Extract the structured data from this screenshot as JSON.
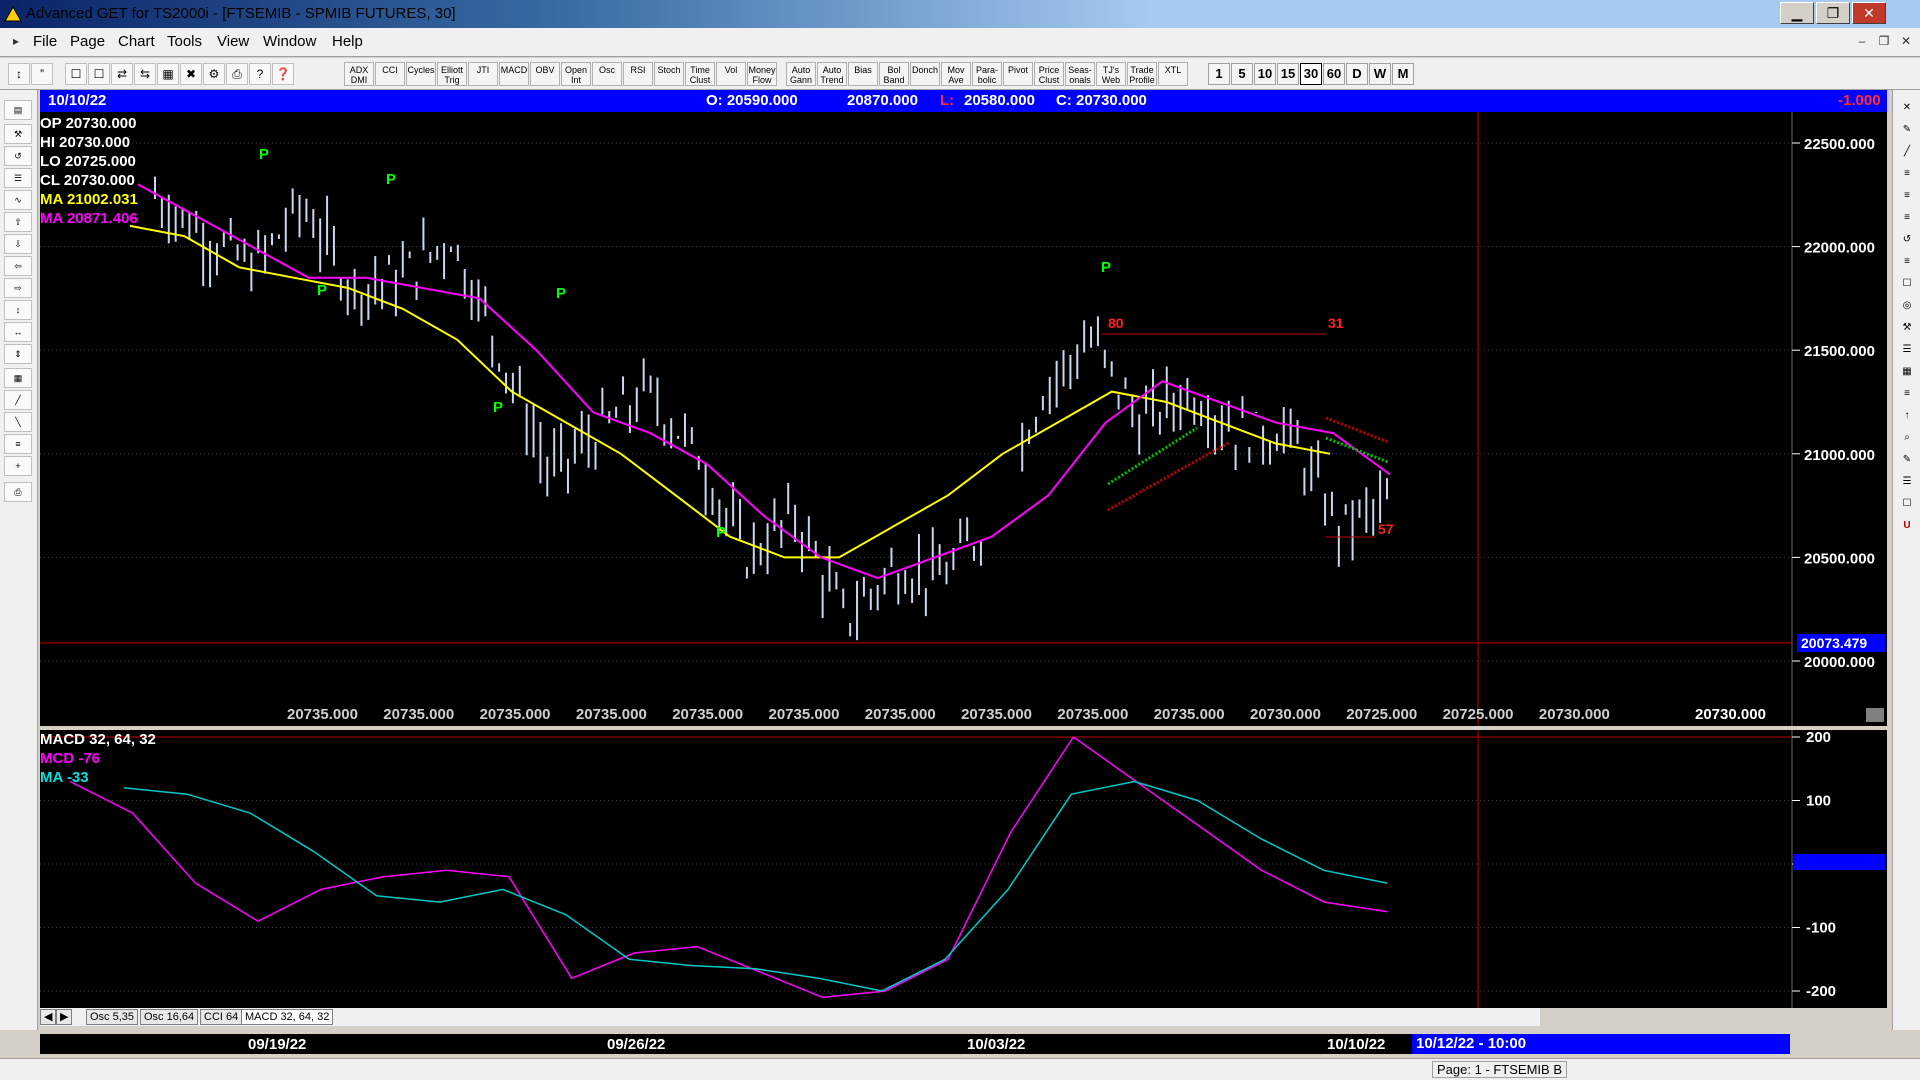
{
  "window": {
    "title": "Advanced GET for TS2000i - [FTSEMIB - SPMIB FUTURES, 30]",
    "minimize": "▁",
    "maximize": "❐",
    "close": "✕"
  },
  "menu": [
    "File",
    "Page",
    "Chart",
    "Tools",
    "View",
    "Window",
    "Help"
  ],
  "toolbar": {
    "study_buttons": [
      "ADX DMI",
      "CCI",
      "Cycles",
      "Elliott Trig",
      "JTI",
      "MACD",
      "OBV",
      "Open Int",
      "Osc",
      "RSI",
      "Stoch",
      "Time Clust",
      "Vol",
      "Money Flow",
      "Auto Gann",
      "Auto Trend",
      "Bias",
      "Bol Band",
      "Donch",
      "Mov Ave",
      "Para-bolic",
      "Pivot",
      "Price Clust",
      "Seas-onals",
      "TJ's Web",
      "Trade Profile",
      "XTL"
    ],
    "timeframes": [
      "1",
      "5",
      "10",
      "15",
      "30",
      "60",
      "D",
      "W",
      "M"
    ],
    "active_timeframe": "30"
  },
  "info_bar": {
    "date": "10/10/22",
    "open": "O: 20590.000",
    "high": "20870.000",
    "low_prefix": "L:",
    "low": "20580.000",
    "close": "C: 20730.000",
    "change": "-1.000"
  },
  "readouts": {
    "op": "OP  20730.000",
    "hi": "HI   20730.000",
    "lo": "LO   20725.000",
    "cl": "CL   20730.000",
    "ma1": "MA  21002.031",
    "ma2": "MA  20871.406"
  },
  "price_axis": [
    "22500.000",
    "22000.000",
    "21500.000",
    "21000.000",
    "20500.000",
    "20000.000"
  ],
  "cursor_price": "20073.479",
  "bottom_values": [
    "20735.000",
    "20735.000",
    "20735.000",
    "20735.000",
    "20735.000",
    "20735.000",
    "20735.000",
    "20735.000",
    "20735.000",
    "20735.000",
    "20730.000",
    "20725.000",
    "20725.000",
    "20730.000",
    "20730.000"
  ],
  "pivot_marks": [
    "P",
    "P",
    "P",
    "P",
    "P",
    "P",
    "P",
    "P"
  ],
  "annotations": {
    "a80": "80",
    "a31": "31",
    "a57": "57"
  },
  "macd": {
    "title": "MACD 32, 64, 32",
    "mcd": "MCD -76",
    "ma": "MA   -33",
    "axis": [
      "200",
      "100",
      "0",
      "-100",
      "-200"
    ]
  },
  "tabs": [
    "Osc 5,35",
    "Osc 16,64",
    "CCI 64",
    "MACD 32, 64, 32"
  ],
  "dates": [
    "09/19/22",
    "09/26/22",
    "10/03/22",
    "10/10/22"
  ],
  "date_cursor": "10/12/22 - 10:00",
  "status": "Page: 1 - FTSEMIB B",
  "colors": {
    "ma_yellow": "#ffff00",
    "ma_magenta": "#ff00ff",
    "bars": "#c8d8f0",
    "signal": "#00c8c8",
    "pivot": "#00ff00",
    "cursor": "#c00000"
  },
  "chart_data": [
    {
      "type": "line",
      "title": "",
      "ylabel": "",
      "ylim": [
        19900,
        22600
      ],
      "x": [
        "09/19/22",
        "09/26/22",
        "10/03/22",
        "10/10/22"
      ],
      "series": [
        {
          "name": "",
          "values": [
            22250,
            22050,
            21900,
            22200,
            21800,
            21850,
            22050,
            21500,
            20900,
            21100,
            21300,
            21000,
            20500,
            20700,
            20200,
            20450,
            20400,
            20700,
            21300,
            21550,
            21150,
            21300,
            21100,
            21100,
            20650,
            20750
          ]
        },
        {
          "name": "",
          "values": [
            22100,
            22050,
            21900,
            21850,
            21800,
            21700,
            21550,
            21300,
            21150,
            21000,
            20800,
            20600,
            20500,
            20500,
            20650,
            20800,
            21000,
            21150,
            21300,
            21250,
            21150,
            21050,
            21000
          ]
        },
        {
          "name": "",
          "values": [
            22300,
            22150,
            22000,
            21850,
            21850,
            21800,
            21750,
            21500,
            21200,
            21100,
            20950,
            20700,
            20500,
            20400,
            20500,
            20600,
            20800,
            21150,
            21350,
            21250,
            21150,
            21100,
            20900
          ]
        }
      ]
    },
    {
      "type": "line",
      "title": "MACD 32, 64, 32",
      "ylim": [
        -220,
        210
      ],
      "series": [
        {
          "name": "MCD",
          "values": [
            130,
            80,
            -30,
            -90,
            -40,
            -20,
            -10,
            -20,
            -180,
            -140,
            -130,
            -170,
            -210,
            -200,
            -150,
            50,
            200,
            130,
            60,
            -10,
            -60,
            -75
          ]
        },
        {
          "name": "MA",
          "values": [
            120,
            110,
            80,
            20,
            -50,
            -60,
            -40,
            -80,
            -150,
            -160,
            -165,
            -180,
            -200,
            -150,
            -40,
            110,
            130,
            100,
            40,
            -10,
            -30
          ]
        }
      ]
    }
  ]
}
